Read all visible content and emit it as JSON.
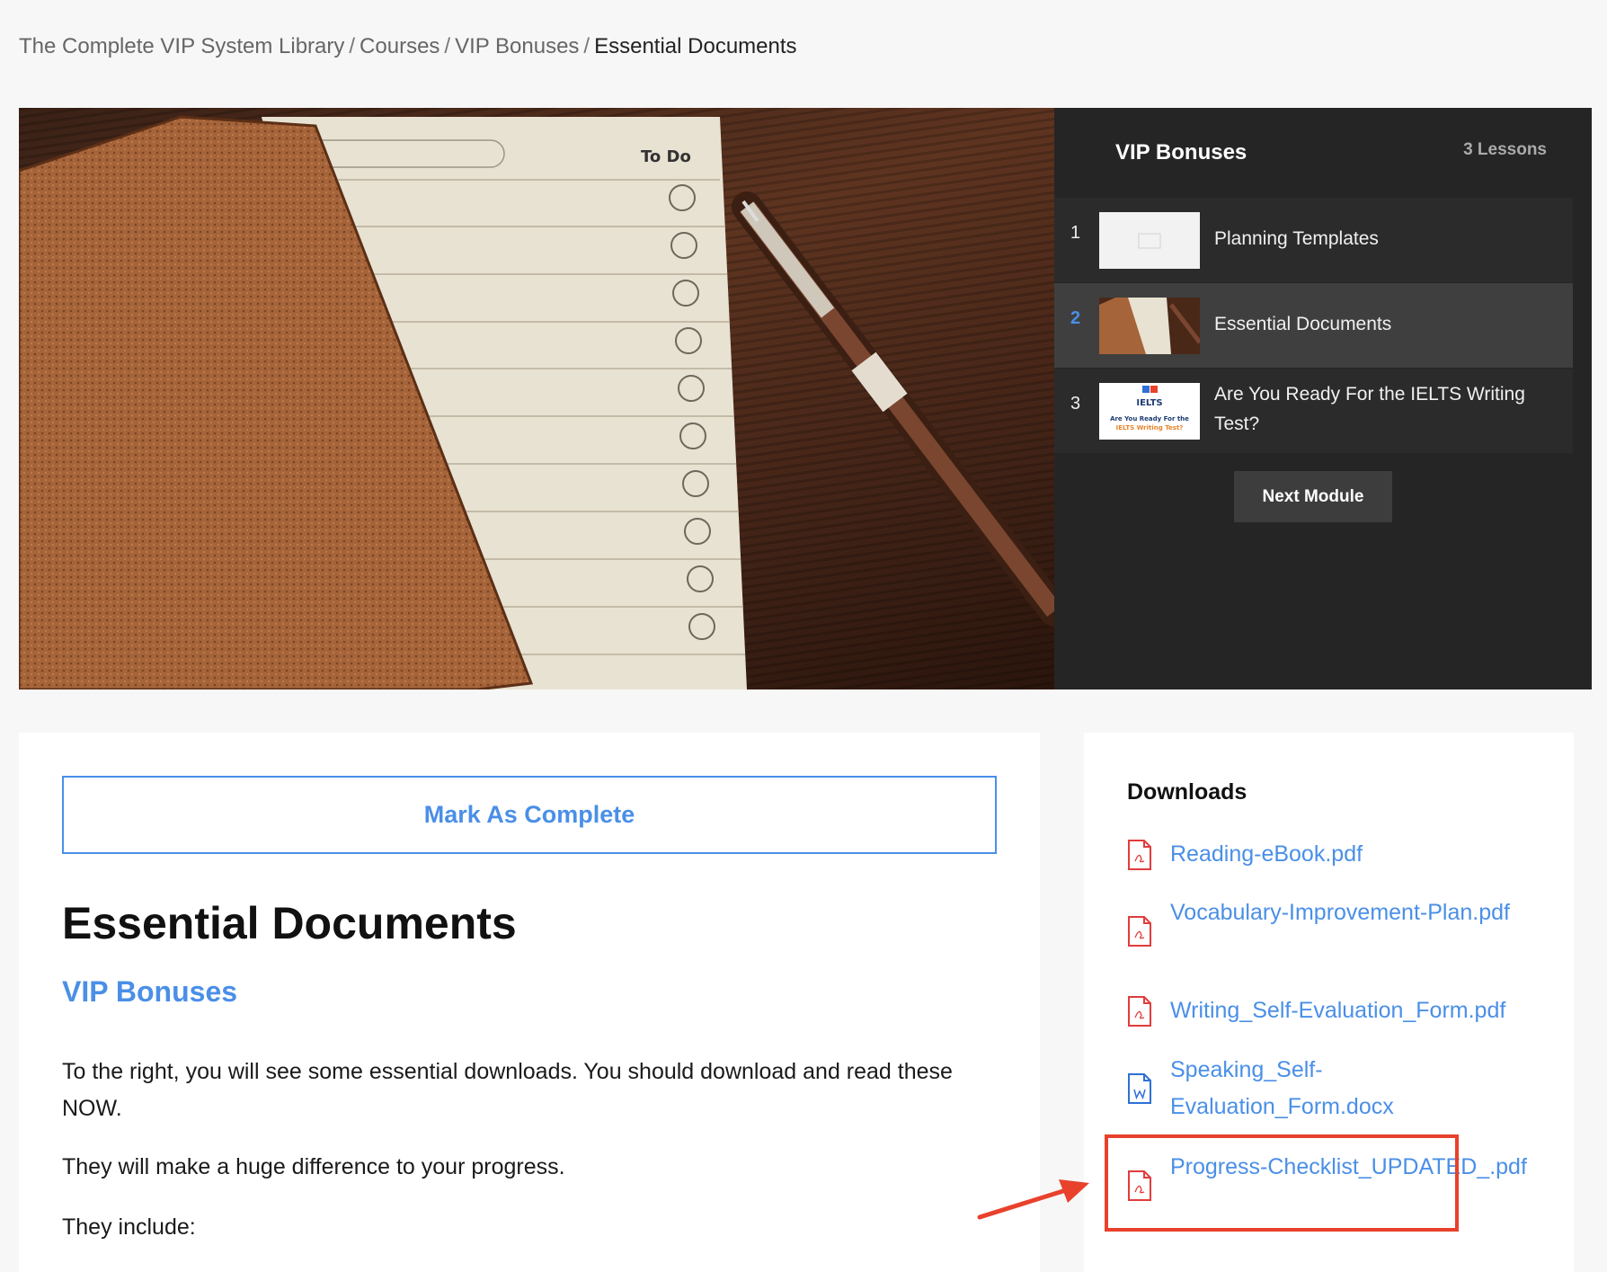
{
  "breadcrumb": {
    "items": [
      "The Complete VIP System Library",
      "Courses",
      "VIP Bonuses"
    ],
    "separator": "/",
    "current": "Essential Documents"
  },
  "hero": {
    "image_todo_label": "To Do"
  },
  "module_panel": {
    "title": "VIP Bonuses",
    "lesson_count": "3 Lessons",
    "lessons": [
      {
        "num": "1",
        "title": "Planning Templates",
        "thumb": "blank-thumbnail"
      },
      {
        "num": "2",
        "title": "Essential Documents",
        "thumb": "notebook-thumbnail",
        "active": true
      },
      {
        "num": "3",
        "title": "Are You Ready For the IELTS Writing Test?",
        "thumb": "ielts-thumbnail",
        "thumb_text": {
          "brand": "IELTS",
          "caption_1": "Are You Ready For the",
          "caption_2": "IELTS Writing Test?"
        }
      }
    ],
    "next_button": "Next Module"
  },
  "main": {
    "complete_button": "Mark As Complete",
    "heading": "Essential Documents",
    "module_name": "VIP Bonuses",
    "paragraphs": [
      "To the right, you will see some essential downloads. You should download and read these NOW.",
      "They will make a huge difference to your progress.",
      "They include:"
    ]
  },
  "downloads": {
    "title": "Downloads",
    "files": [
      {
        "name": "Reading-eBook.pdf",
        "icon": "pdf-icon"
      },
      {
        "name": "Vocabulary-Improvement-Plan.pdf",
        "icon": "pdf-icon"
      },
      {
        "name": "Writing_Self-Evaluation_Form.pdf",
        "icon": "pdf-icon"
      },
      {
        "name": "Speaking_Self-Evaluation_Form.docx",
        "icon": "word-icon"
      },
      {
        "name": "Progress-Checklist_UPDATED_.pdf",
        "icon": "pdf-icon"
      }
    ]
  },
  "colors": {
    "accent": "#4a8fe7",
    "annotation": "#e8412c",
    "panel": "#252525",
    "pdf": "#e23c3c",
    "word": "#2f6fd6"
  }
}
